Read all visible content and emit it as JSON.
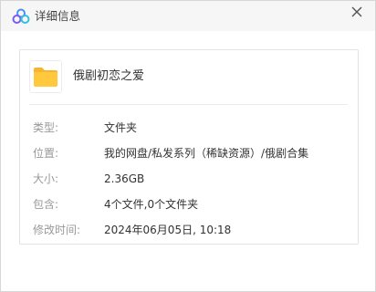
{
  "window": {
    "title": "详细信息",
    "logo_icon": "cloud-logo-icon",
    "close_icon": "close-icon"
  },
  "file": {
    "name": "俄剧初恋之爱",
    "icon": "folder-icon",
    "icon_color": "#ffc83d"
  },
  "details": [
    {
      "label": "类型:",
      "value": "文件夹"
    },
    {
      "label": "位置:",
      "value": "我的网盘/私发系列（稀缺资源）/俄剧合集"
    },
    {
      "label": "大小:",
      "value": "2.36GB"
    },
    {
      "label": "包含:",
      "value": "4个文件,0个文件夹"
    },
    {
      "label": "修改时间:",
      "value": "2024年06月05日, 10:18"
    }
  ]
}
